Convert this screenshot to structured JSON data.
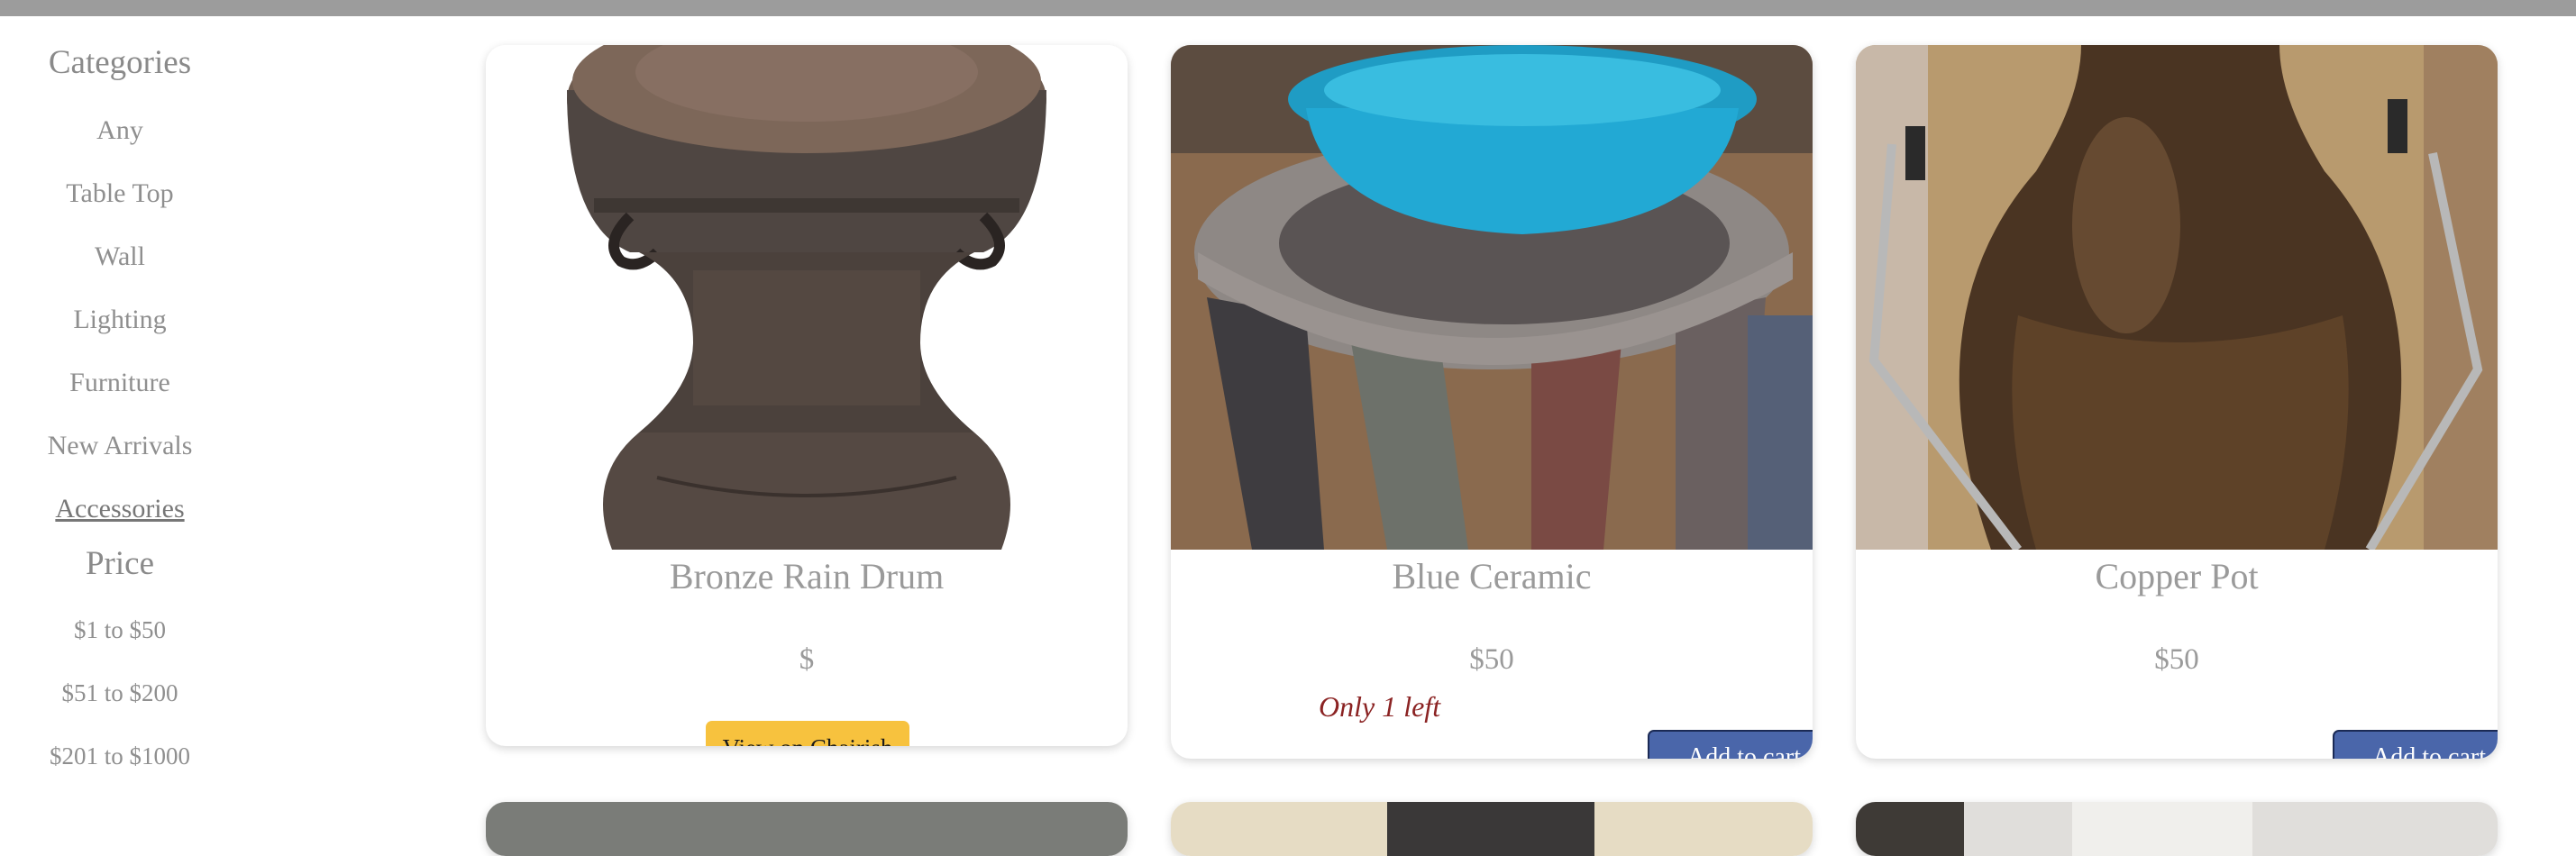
{
  "sidebar": {
    "categories_heading": "Categories",
    "categories": [
      {
        "label": "Any"
      },
      {
        "label": "Table Top"
      },
      {
        "label": "Wall"
      },
      {
        "label": "Lighting"
      },
      {
        "label": "Furniture"
      },
      {
        "label": "New Arrivals"
      },
      {
        "label": "Accessories",
        "active": true
      }
    ],
    "price_heading": "Price",
    "prices": [
      {
        "label": "$1 to $50"
      },
      {
        "label": "$51 to $200"
      },
      {
        "label": "$201 to $1000"
      }
    ]
  },
  "products": [
    {
      "title": "Bronze Rain Drum",
      "price": "$",
      "action_label": "View on Chairish",
      "action_color": "#f7c23e"
    },
    {
      "title": "Blue Ceramic",
      "price": "$50",
      "stock_note": "Only 1 left",
      "action_label": "Add to cart",
      "action_color": "#4a66aa"
    },
    {
      "title": "Copper Pot",
      "price": "$50",
      "action_label": "Add to cart",
      "action_color": "#4a66aa"
    }
  ],
  "colors": {
    "top_bar": "#9c9c9c",
    "sidebar_text": "#8f8f8f",
    "stock_note": "#8b2323"
  }
}
